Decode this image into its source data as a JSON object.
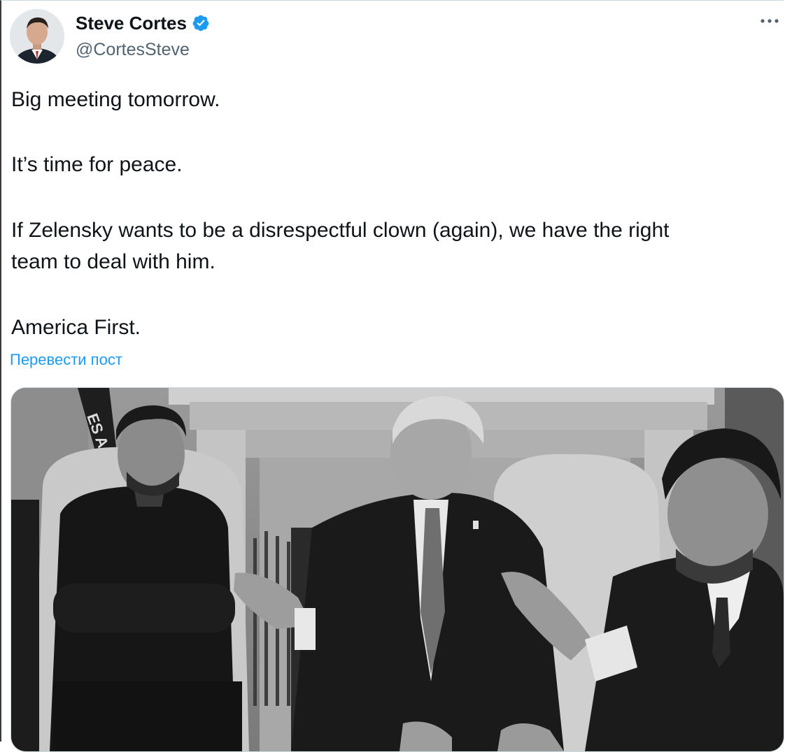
{
  "tweet": {
    "author": {
      "name": "Steve Cortes",
      "handle": "@CortesSteve",
      "verified": true
    },
    "more_icon": "more-options-icon",
    "text": {
      "p1": "Big meeting tomorrow.",
      "p2": "It’s time for peace.",
      "p3_line1": "If Zelensky wants to be a disrespectful clown (again), we have the right",
      "p3_line2": "team to deal with him.",
      "p4": "America First."
    },
    "translate_link": "Перевести пост",
    "media": {
      "type": "photo",
      "style": "black-and-white",
      "flag_text": "ES A"
    }
  },
  "colors": {
    "accent": "#1d9bf0",
    "text_primary": "#0f1419",
    "text_secondary": "#536471"
  }
}
